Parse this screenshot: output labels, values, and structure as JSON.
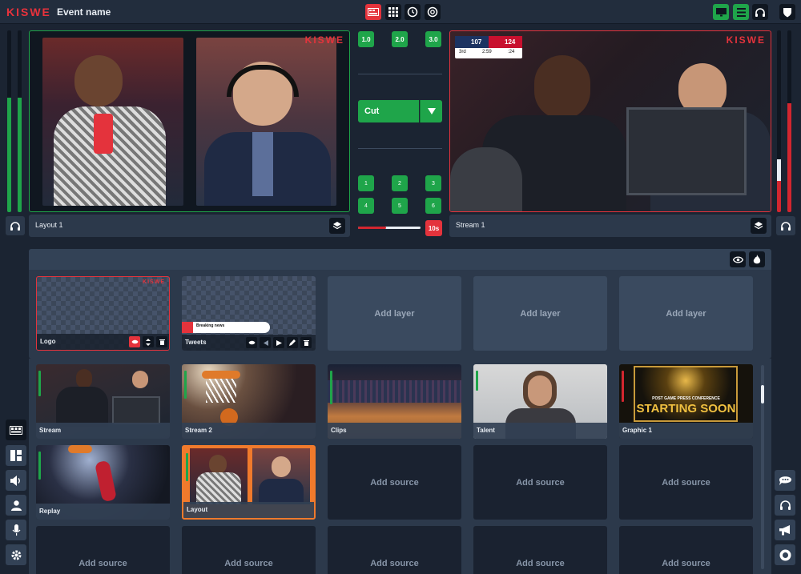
{
  "app": {
    "logo": "KISWE",
    "event_name": "Event name"
  },
  "toolbar": {
    "left_icons": [
      "switcher-icon",
      "grid-icon",
      "replay-icon",
      "zoom-icon"
    ],
    "right_icons": [
      "monitor-icon",
      "list-icon",
      "headset-icon"
    ],
    "user_icon": "shield-icon"
  },
  "preview": {
    "watermark": "KISWE",
    "label": "Layout 1",
    "border_color": "#1fa54a",
    "audio_levels": [
      0.63,
      0.63
    ]
  },
  "program": {
    "watermark": "KISWE",
    "label": "Stream 1",
    "border_color": "#e4333c",
    "scorebug": {
      "away_score": "107",
      "home_score": "124",
      "period": "3rd",
      "clock": "2:59",
      "shot_clock": ":24"
    },
    "audio_levels": [
      0.17,
      0.6
    ]
  },
  "transition": {
    "speed_buttons": [
      "1.0",
      "2.0",
      "3.0"
    ],
    "cut_label": "Cut",
    "pins": [
      "1",
      "2",
      "3",
      "4",
      "5",
      "6"
    ],
    "tbar_progress": 0.45,
    "duration_label": "10s"
  },
  "layers": {
    "header_icons": [
      "eye-icon",
      "fire-icon"
    ],
    "items": [
      {
        "label": "Logo",
        "watermark": "KISWE",
        "active": true
      },
      {
        "label": "Tweets",
        "ticker": "Breaking news"
      },
      {
        "add_label": "Add layer"
      },
      {
        "add_label": "Add layer"
      },
      {
        "add_label": "Add layer"
      }
    ]
  },
  "sources": {
    "items": [
      {
        "label": "Stream",
        "level": 0.45
      },
      {
        "label": "Stream 2",
        "level": 0.5
      },
      {
        "label": "Clips",
        "level": 0.6
      },
      {
        "label": "Talent",
        "level": 0.35
      },
      {
        "label": "Graphic 1",
        "level": 0.55,
        "title_top": "POST GAME PRESS CONFERENCE",
        "title_main": "STARTING SOON"
      },
      {
        "label": "Replay",
        "level": 0.5
      },
      {
        "label": "Layout",
        "level": 0.5,
        "selected": true
      },
      {
        "add_label": "Add source"
      },
      {
        "add_label": "Add source"
      },
      {
        "add_label": "Add source"
      },
      {
        "add_label": "Add source"
      },
      {
        "add_label": "Add source"
      },
      {
        "add_label": "Add source"
      },
      {
        "add_label": "Add source"
      },
      {
        "add_label": "Add source"
      }
    ]
  },
  "left_sidebar": [
    "switcher-icon",
    "layout-icon",
    "speaker-icon",
    "person-icon",
    "microphone-icon",
    "gear-icon"
  ],
  "right_sidebar": [
    "chat-icon",
    "headset-icon",
    "megaphone-icon",
    "record-icon"
  ],
  "colors": {
    "accent_green": "#1fa54a",
    "accent_red": "#e4333c",
    "selection_orange": "#f07a2c"
  }
}
